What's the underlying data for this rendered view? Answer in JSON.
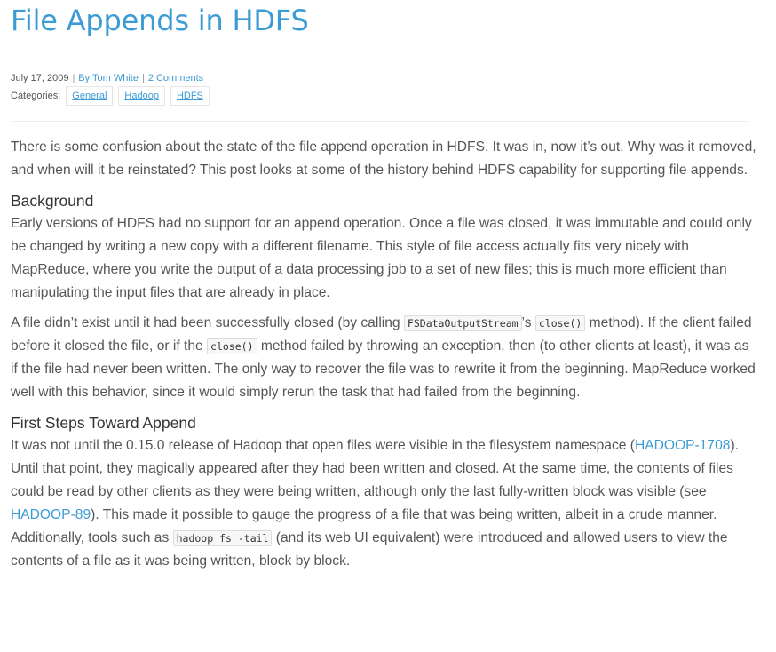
{
  "post": {
    "title": "File Appends in HDFS",
    "date": "July 17, 2009",
    "author": "By Tom White",
    "comments": "2 Comments",
    "categories_label": "Categories:",
    "categories": [
      "General",
      "Hadoop",
      "HDFS"
    ]
  },
  "body": {
    "intro": "There is some confusion about the state of the file append operation in HDFS. It was in, now it’s out. Why was it removed, and when will it be reinstated? This post looks at some of the history behind HDFS capability for supporting file appends.",
    "h_background": "Background",
    "p_background": "Early versions of HDFS had no support for an append operation. Once a file was closed, it was immutable and could only be changed by writing a new copy with a different filename. This style of file access actually fits very nicely with MapReduce, where you write the output of a data processing job to a set of new files; this is much more efficient than manipulating the input files that are already in place.",
    "p2": {
      "a": "A file didn’t exist until it had been successfully closed (by calling ",
      "code1": "FSDataOutputStream",
      "b": "’s ",
      "code2": "close()",
      "c": " method). If the client failed before it closed the file, or if the ",
      "code3": "close()",
      "d": " method failed by throwing an exception, then (to other clients at least), it was as if the file had never been written. The only way to recover the file was to rewrite it from the beginning. MapReduce worked well with this behavior, since it would simply rerun the task that had failed from the beginning."
    },
    "h_first_steps": "First Steps Toward Append",
    "p3": {
      "a": "It was not until the 0.15.0 release of Hadoop that open files were visible in the filesystem namespace (",
      "link1": "HADOOP-1708",
      "b": "). Until that point, they magically appeared after they had been written and closed. At the same time, the contents of files could be read by other clients as they were being written, although only the last fully-written block was visible (see ",
      "link2": "HADOOP-89",
      "c": "). This made it possible to gauge the progress of a file that was being written, albeit in a crude manner. Additionally, tools such as ",
      "code1": "hadoop fs -tail",
      "d": " (and its web UI equivalent) were introduced and allowed users to view the contents of a file as it was being written, block by block."
    }
  },
  "colors": {
    "accent": "#3a9bd5",
    "text": "#555555",
    "heading": "#333333"
  }
}
